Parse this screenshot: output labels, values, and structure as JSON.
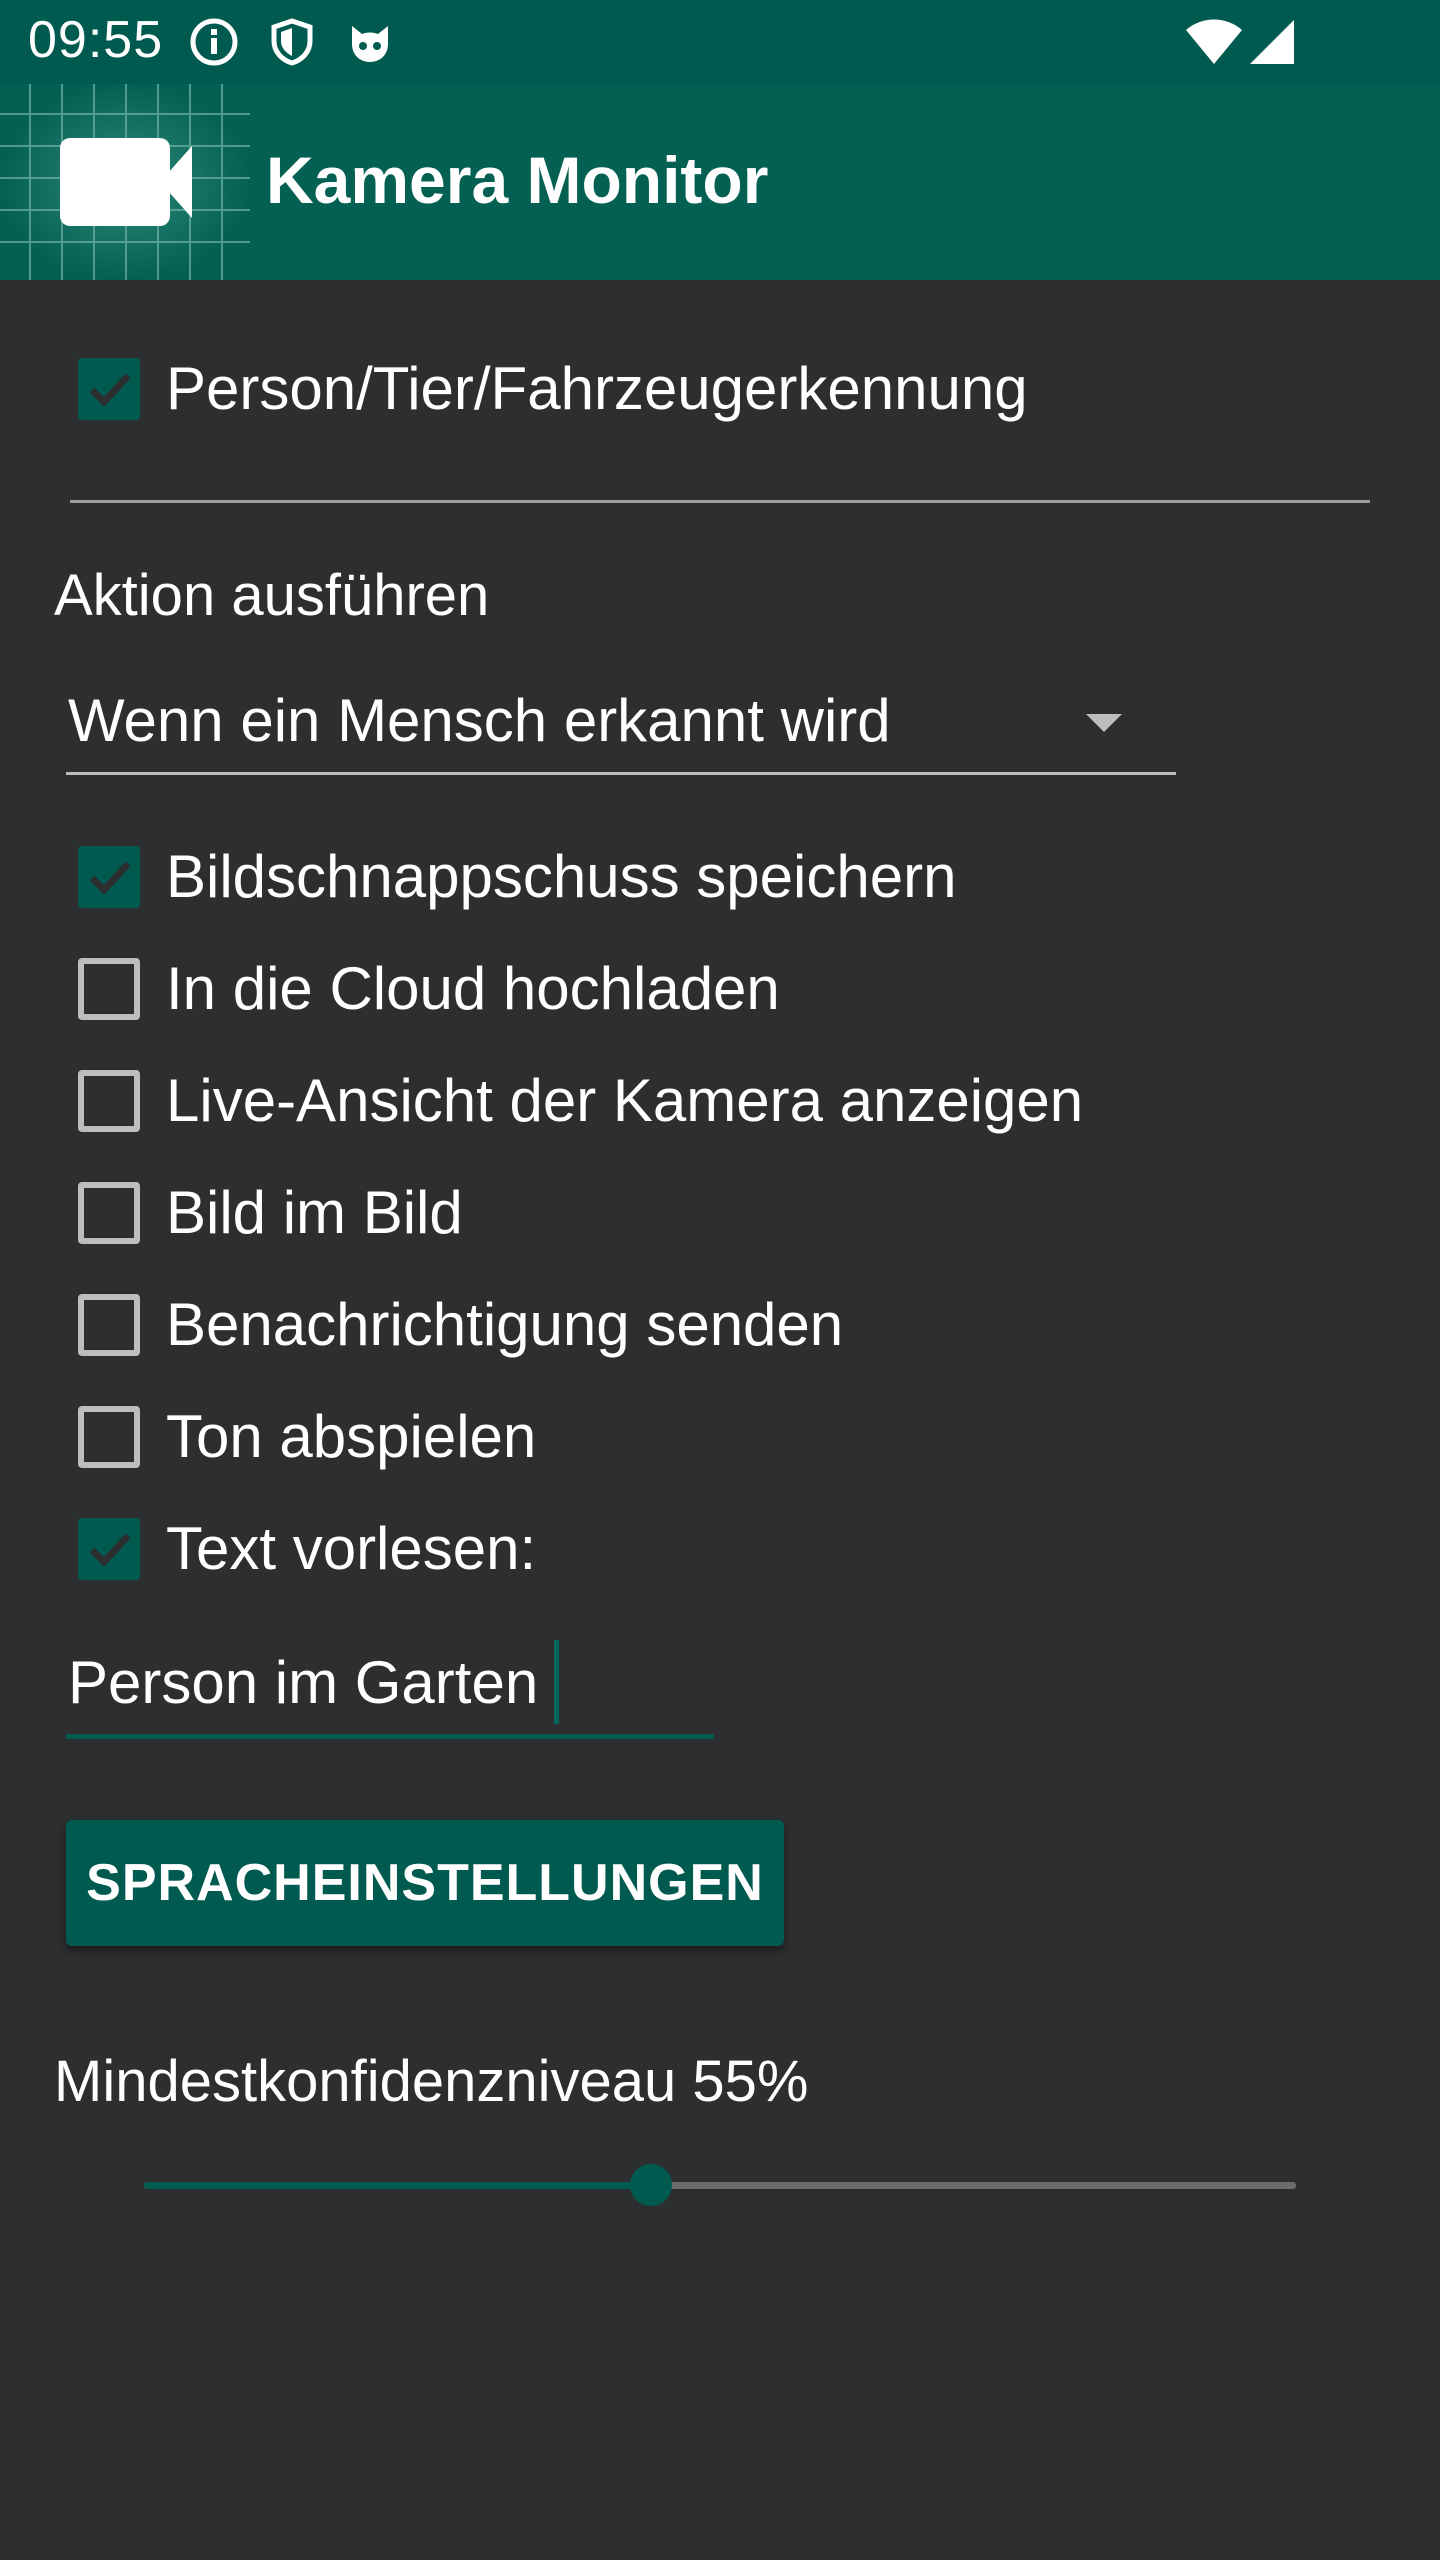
{
  "status_bar": {
    "time": "09:55",
    "icons": [
      "info-icon",
      "shield-icon",
      "cat-icon",
      "wifi-icon",
      "signal-icon"
    ]
  },
  "app_bar": {
    "title": "Kamera Monitor",
    "logo_icon": "video-camera-icon",
    "color": "#046052"
  },
  "detection": {
    "label": "Person/Tier/Fahrzeugerkennung",
    "checked": true
  },
  "action": {
    "section_label": "Aktion ausführen",
    "dropdown_value": "Wenn ein Mensch erkannt wird"
  },
  "options": [
    {
      "label": "Bildschnappschuss speichern",
      "checked": true
    },
    {
      "label": "In die Cloud hochladen",
      "checked": false
    },
    {
      "label": "Live-Ansicht der Kamera anzeigen",
      "checked": false
    },
    {
      "label": "Bild im Bild",
      "checked": false
    },
    {
      "label": "Benachrichtigung senden",
      "checked": false
    },
    {
      "label": "Ton abspielen",
      "checked": false
    },
    {
      "label": "Text vorlesen:",
      "checked": true
    }
  ],
  "speech_text": {
    "value": "Person im Garten"
  },
  "buttons": {
    "speech_settings": "SPRACHEINSTELLUNGEN"
  },
  "confidence": {
    "label": "Mindestkonfidenzniveau 55%",
    "value_percent": 55
  },
  "colors": {
    "accent": "#005a4f",
    "background": "#2d2e30"
  }
}
